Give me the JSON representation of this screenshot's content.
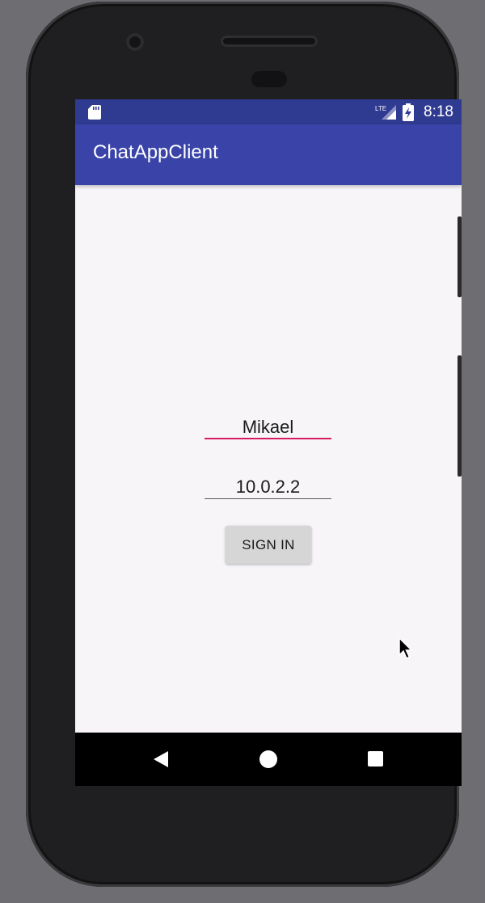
{
  "status_bar": {
    "time": "8:18",
    "network": "LTE",
    "icons": [
      "sd-card-icon",
      "signal-icon",
      "battery-charging-icon"
    ]
  },
  "app_bar": {
    "title": "ChatAppClient"
  },
  "form": {
    "name_value": "Mikael",
    "host_value": "10.0.2.2",
    "sign_in_label": "SIGN IN"
  },
  "nav_bar": {
    "icons": [
      "back-icon",
      "home-icon",
      "recent-apps-icon"
    ]
  },
  "colors": {
    "status_bar": "#2f3a91",
    "app_bar": "#3a44a8",
    "accent": "#d81b60",
    "background": "#f7f5f8"
  }
}
